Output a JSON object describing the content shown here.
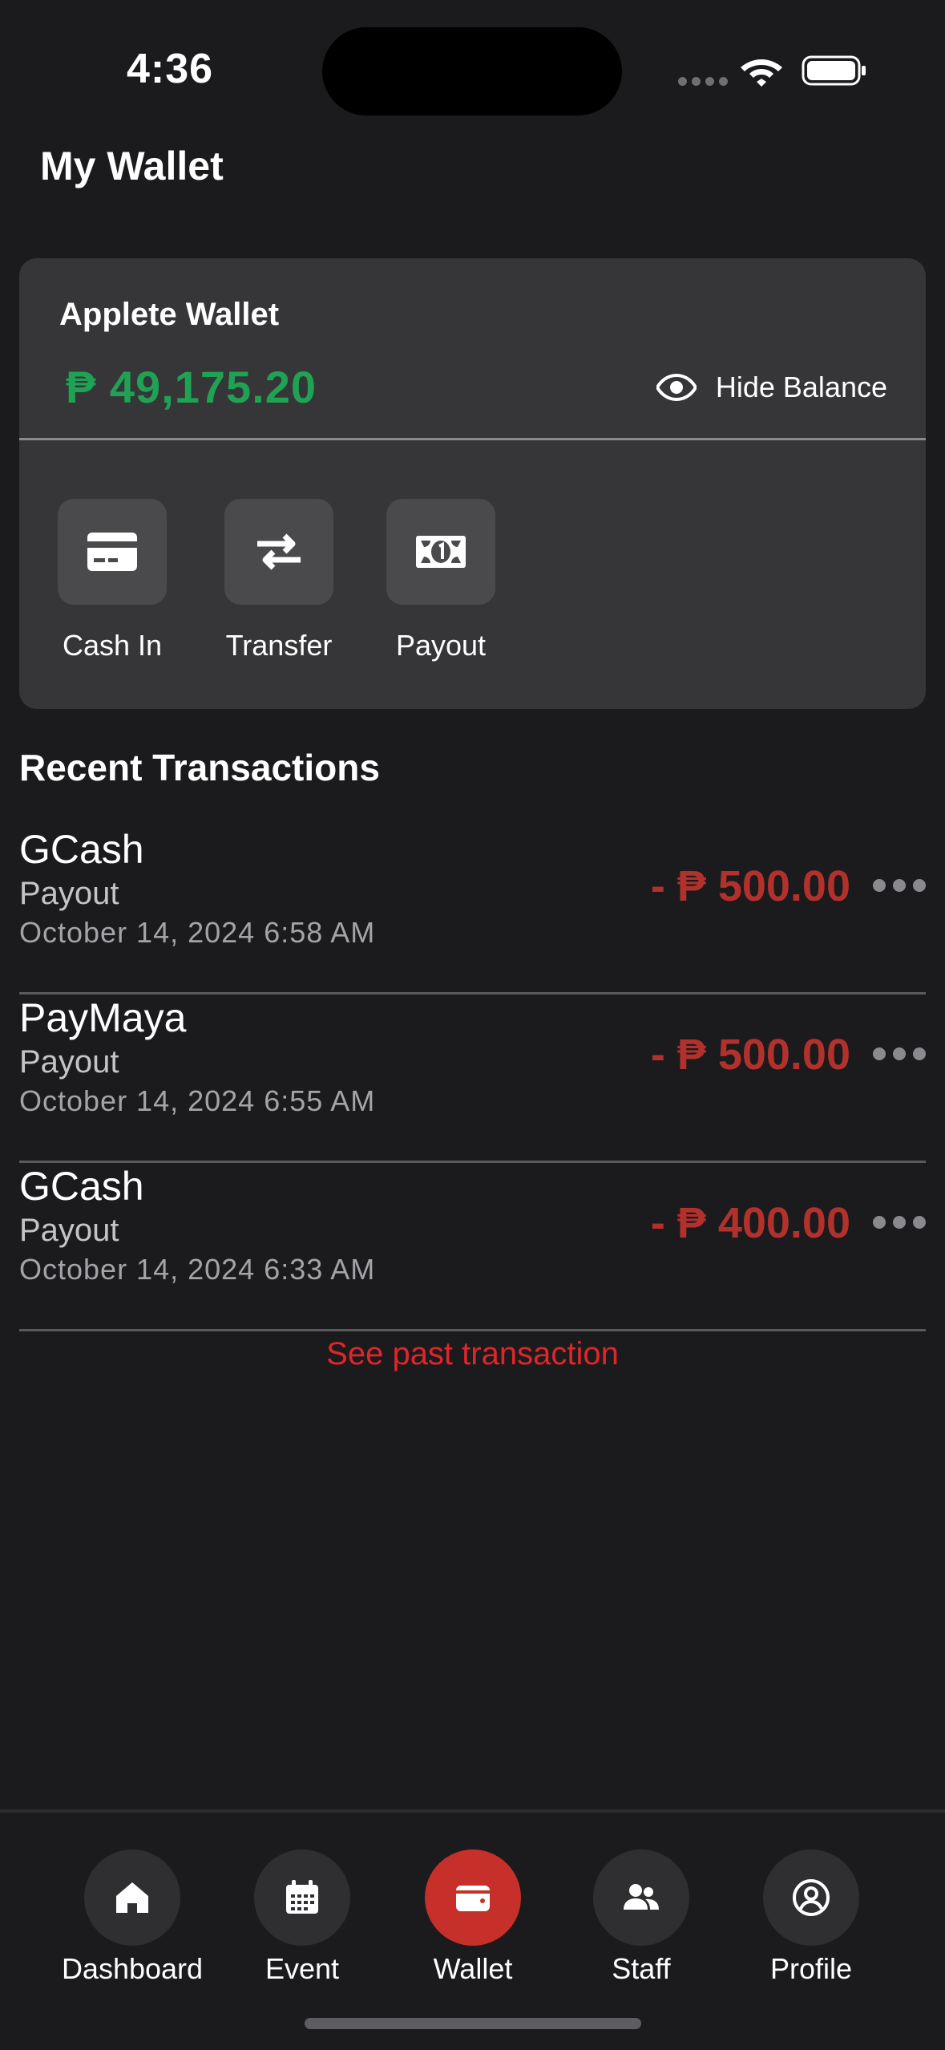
{
  "status_bar": {
    "time": "4:36",
    "icons": [
      "signal-dots-icon",
      "wifi-icon",
      "battery-icon"
    ]
  },
  "header": {
    "title": "My Wallet"
  },
  "wallet": {
    "name": "Applete Wallet",
    "balance": "₱ 49,175.20",
    "hide_balance_label": "Hide Balance",
    "hide_balance_icon": "eye-icon",
    "actions": [
      {
        "label": "Cash In",
        "icon": "credit-card-icon"
      },
      {
        "label": "Transfer",
        "icon": "transfer-arrows-icon"
      },
      {
        "label": "Payout",
        "icon": "money-bill-icon"
      }
    ]
  },
  "transactions": {
    "title": "Recent Transactions",
    "items": [
      {
        "name": "GCash",
        "type": "Payout",
        "date": "October 14, 2024 6:58 AM",
        "amount": "- ₱ 500.00"
      },
      {
        "name": "PayMaya",
        "type": "Payout",
        "date": "October 14, 2024 6:55 AM",
        "amount": "- ₱ 500.00"
      },
      {
        "name": "GCash",
        "type": "Payout",
        "date": "October 14, 2024 6:33 AM",
        "amount": "- ₱ 400.00"
      }
    ],
    "see_past_label": "See past transaction"
  },
  "tabbar": {
    "active": "Wallet",
    "tabs": [
      {
        "label": "Dashboard",
        "icon": "home-icon"
      },
      {
        "label": "Event",
        "icon": "calendar-icon"
      },
      {
        "label": "Wallet",
        "icon": "wallet-icon"
      },
      {
        "label": "Staff",
        "icon": "people-icon"
      },
      {
        "label": "Profile",
        "icon": "user-circle-icon"
      }
    ]
  },
  "colors": {
    "background": "#1b1b1d",
    "card": "#363638",
    "balance_green": "#20a254",
    "amount_red": "#b2312c",
    "link_red": "#e0252b",
    "active_tab": "#c62f2a"
  }
}
